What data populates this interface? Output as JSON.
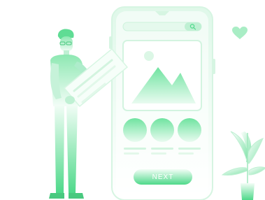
{
  "screen": {
    "next_button": {
      "label": "NEXT"
    },
    "icons": {
      "search": "search-icon",
      "image": "image-placeholder-icon",
      "heart": "heart-icon"
    },
    "colors": {
      "accent": "#4ed98a",
      "accent_light": "#c8f3d8",
      "accent_pale": "#eafaf0",
      "outline": "#d6f5e2"
    }
  }
}
